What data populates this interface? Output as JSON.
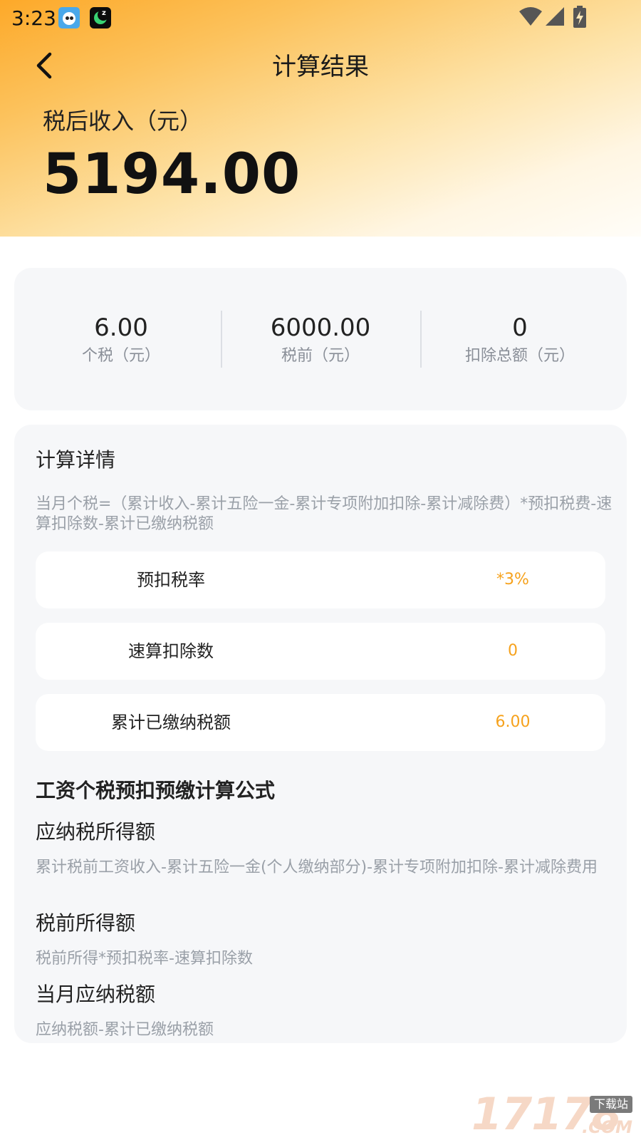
{
  "status_bar": {
    "time": "3:23"
  },
  "nav": {
    "title": "计算结果"
  },
  "income": {
    "label": "税后收入（元）",
    "value": "5194.00"
  },
  "summary": [
    {
      "value": "6.00",
      "label": "个税（元）"
    },
    {
      "value": "6000.00",
      "label": "税前（元）"
    },
    {
      "value": "0",
      "label": "扣除总额（元）"
    }
  ],
  "details": {
    "title": "计算详情",
    "formula": "当月个税=（累计收入-累计五险一金-累计专项附加扣除-累计减除费）*预扣税费-速算扣除数-累计已缴纳税额",
    "rows": [
      {
        "label": "预扣税率",
        "value": "*3%"
      },
      {
        "label": "速算扣除数",
        "value": "0"
      },
      {
        "label": "累计已缴纳税额",
        "value": "6.00"
      }
    ],
    "section_title": "工资个税预扣预缴计算公式",
    "items": [
      {
        "title": "应纳税所得额",
        "desc": "累计税前工资收入-累计五险一金(个人缴纳部分)-累计专项附加扣除-累计减除费用"
      },
      {
        "title": "税前所得额",
        "desc": "税前所得*预扣税率-速算扣除数"
      },
      {
        "title": "当月应纳税额",
        "desc": "应纳税额-累计已缴纳税额"
      }
    ]
  },
  "watermark": {
    "number": "17178",
    "badge": "下载站",
    "suffix": ".COM"
  },
  "colors": {
    "accent": "#f6a21d",
    "header_start": "#fda929",
    "card_bg": "#f6f7f9"
  }
}
